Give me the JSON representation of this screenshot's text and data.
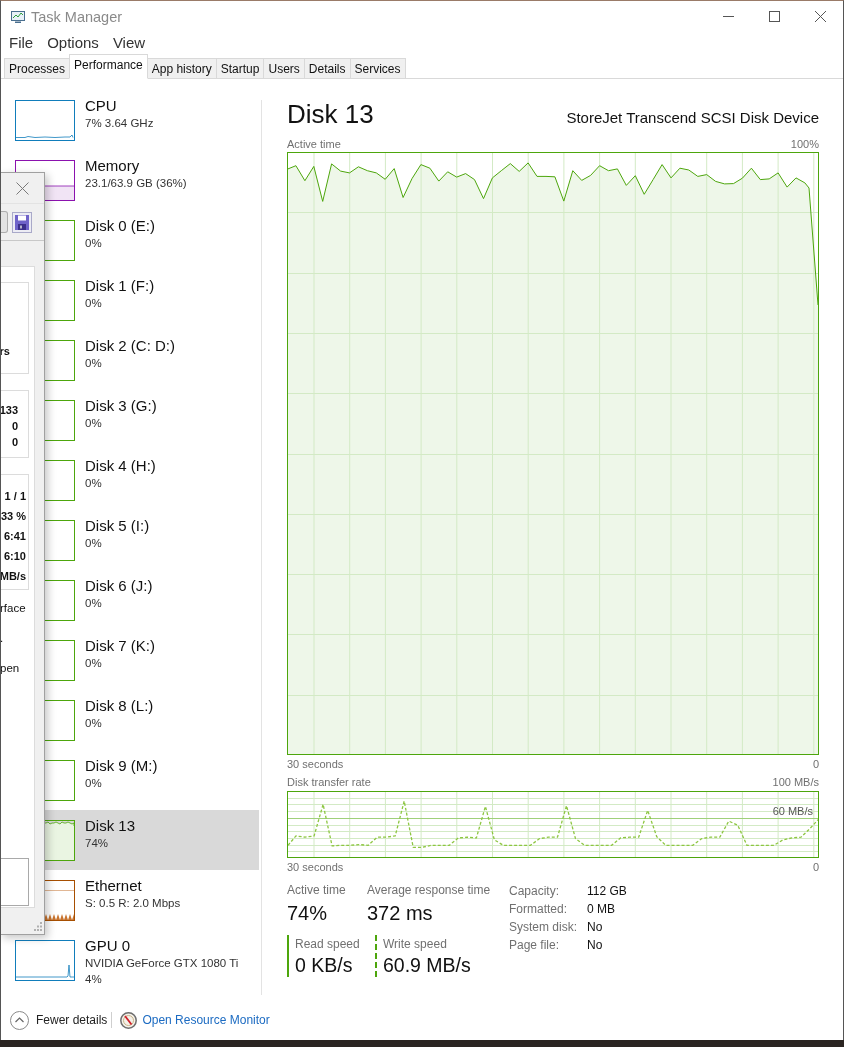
{
  "window": {
    "title": "Task Manager"
  },
  "menu": [
    "File",
    "Options",
    "View"
  ],
  "tabs": [
    {
      "label": "Processes",
      "selected": false
    },
    {
      "label": "Performance",
      "selected": true
    },
    {
      "label": "App history",
      "selected": false
    },
    {
      "label": "Startup",
      "selected": false
    },
    {
      "label": "Users",
      "selected": false
    },
    {
      "label": "Details",
      "selected": false
    },
    {
      "label": "Services",
      "selected": false
    }
  ],
  "sidebar": {
    "items": [
      {
        "kind": "cpu",
        "name": "CPU",
        "details": [
          "7% 3.64 GHz"
        ],
        "selected": false
      },
      {
        "kind": "memory",
        "name": "Memory",
        "details": [
          "23.1/63.9 GB (36%)"
        ],
        "selected": false
      },
      {
        "kind": "disk",
        "name": "Disk 0 (E:)",
        "details": [
          "0%"
        ],
        "selected": false
      },
      {
        "kind": "disk",
        "name": "Disk 1 (F:)",
        "details": [
          "0%"
        ],
        "selected": false
      },
      {
        "kind": "disk",
        "name": "Disk 2 (C: D:)",
        "details": [
          "0%"
        ],
        "selected": false
      },
      {
        "kind": "disk",
        "name": "Disk 3 (G:)",
        "details": [
          "0%"
        ],
        "selected": false
      },
      {
        "kind": "disk",
        "name": "Disk 4 (H:)",
        "details": [
          "0%"
        ],
        "selected": false
      },
      {
        "kind": "disk",
        "name": "Disk 5 (I:)",
        "details": [
          "0%"
        ],
        "selected": false
      },
      {
        "kind": "disk",
        "name": "Disk 6 (J:)",
        "details": [
          "0%"
        ],
        "selected": false
      },
      {
        "kind": "disk",
        "name": "Disk 7 (K:)",
        "details": [
          "0%"
        ],
        "selected": false
      },
      {
        "kind": "disk",
        "name": "Disk 8 (L:)",
        "details": [
          "0%"
        ],
        "selected": false
      },
      {
        "kind": "disk",
        "name": "Disk 9 (M:)",
        "details": [
          "0%"
        ],
        "selected": false
      },
      {
        "kind": "activedisk",
        "name": "Disk 13",
        "details": [
          "74%"
        ],
        "selected": true
      },
      {
        "kind": "ethernet",
        "name": "Ethernet",
        "details": [
          "S: 0.5 R: 2.0 Mbps"
        ],
        "selected": false
      },
      {
        "kind": "gpu",
        "name": "GPU 0",
        "details": [
          "NVIDIA GeForce GTX 1080 Ti",
          "4%"
        ],
        "selected": false
      }
    ]
  },
  "detail": {
    "title": "Disk 13",
    "device": "StoreJet Transcend SCSI Disk Device",
    "active_time_graph": {
      "label": "Active time",
      "max_label": "100%",
      "start_label": "30 seconds",
      "end_label": "0"
    },
    "transfer_rate_graph": {
      "label": "Disk transfer rate",
      "max_label": "100 MB/s",
      "reference_label": "60 MB/s",
      "start_label": "30 seconds",
      "end_label": "0"
    },
    "stats": [
      {
        "label": "Active time",
        "value": "74%"
      },
      {
        "label": "Average response time",
        "value": "372 ms"
      }
    ],
    "speeds": [
      {
        "kind": "read",
        "label": "Read speed",
        "value": "0 KB/s"
      },
      {
        "kind": "write",
        "label": "Write speed",
        "value": "60.9 MB/s"
      }
    ],
    "properties": [
      {
        "label": "Capacity:",
        "value": "112 GB"
      },
      {
        "label": "Formatted:",
        "value": "0 MB"
      },
      {
        "label": "System disk:",
        "value": "No"
      },
      {
        "label": "Page file:",
        "value": "No"
      }
    ]
  },
  "footer": {
    "details_toggle": "Fewer details",
    "resource_monitor_link": "Open Resource Monitor"
  },
  "overlapping_window": {
    "groups": [
      {
        "values": [
          "rs"
        ]
      },
      {
        "values": [
          "133",
          "0",
          "0"
        ]
      },
      {
        "values": [
          "1 / 1",
          "33 %",
          "6:41",
          "6:10",
          "MB/s"
        ]
      }
    ],
    "notes": [
      "rface",
      ".",
      "pen"
    ]
  }
}
